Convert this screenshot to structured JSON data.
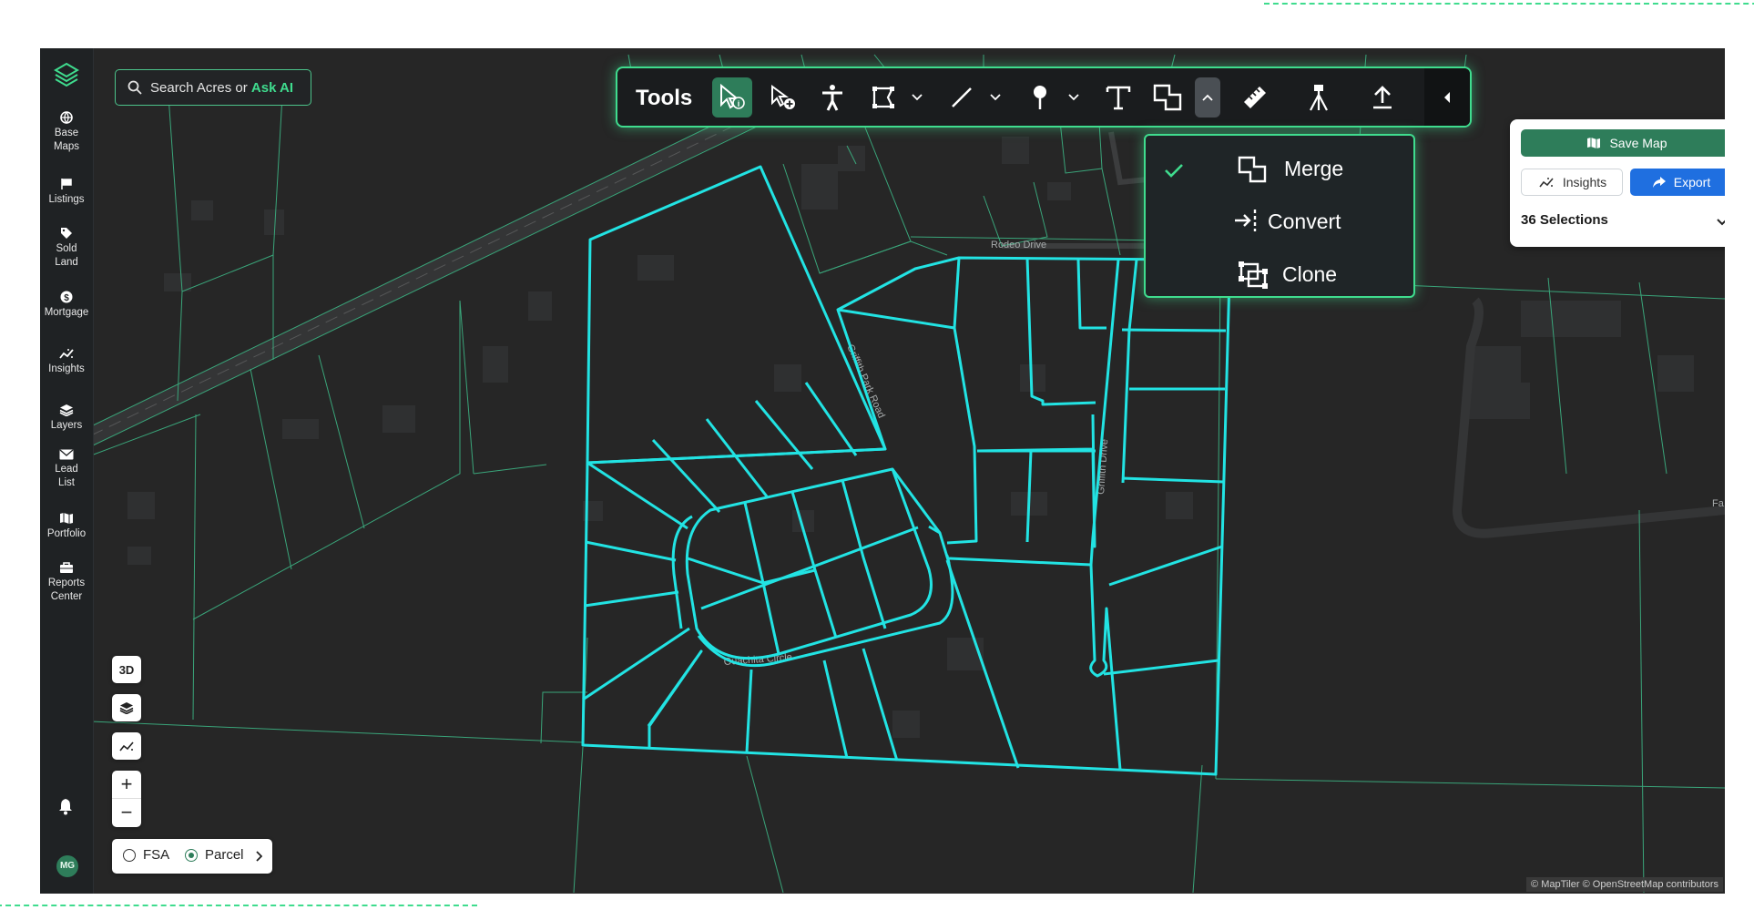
{
  "colors": {
    "accent": "#3fdc8e",
    "parcel_selected": "#22e3e3",
    "parcel_line": "#3aa57a",
    "map_bg": "#262626",
    "save_button": "#2e7d5a",
    "export_button": "#1f6fe0"
  },
  "sidebar": {
    "logo_icon": "layers-logo-icon",
    "items": [
      {
        "label": "Base\nMaps",
        "icon": "globe-icon"
      },
      {
        "label": "Listings",
        "icon": "flag-icon"
      },
      {
        "label": "Sold\nLand",
        "icon": "tag-icon"
      },
      {
        "label": "Mortgage",
        "icon": "dollar-icon"
      },
      {
        "label": "Insights",
        "icon": "chart-icon"
      },
      {
        "label": "Layers",
        "icon": "layers-icon"
      },
      {
        "label": "Lead\nList",
        "icon": "envelope-icon"
      },
      {
        "label": "Portfolio",
        "icon": "map-icon"
      },
      {
        "label": "Reports\nCenter",
        "icon": "briefcase-icon"
      }
    ],
    "notifications_icon": "bell-icon",
    "avatar_initials": "MG"
  },
  "search": {
    "prefix": "Search Acres or ",
    "ask_ai": "Ask AI"
  },
  "toolbar": {
    "label": "Tools",
    "tools": [
      "select-info",
      "select-add",
      "person",
      "polygon",
      "line",
      "pin",
      "text",
      "merge",
      "ruler",
      "survey",
      "upload"
    ],
    "active_tool": "select-info",
    "open_dropdown": "merge"
  },
  "merge_menu": {
    "items": [
      {
        "label": "Merge",
        "icon": "merge-icon",
        "checked": true
      },
      {
        "label": "Convert",
        "icon": "convert-icon",
        "checked": false
      },
      {
        "label": "Clone",
        "icon": "clone-icon",
        "checked": false
      }
    ]
  },
  "panel": {
    "save_label": "Save Map",
    "insights_label": "Insights",
    "export_label": "Export",
    "selections_label": "36 Selections"
  },
  "map": {
    "streets": [
      "Rodeo Drive",
      "Griffith Park Road",
      "Griffith Drive",
      "Ouachita Circle"
    ],
    "edge_label": "Fa",
    "attribution": "© MapTiler © OpenStreetMap contributors"
  },
  "controls": {
    "three_d_label": "3D",
    "zoom_in": "+",
    "zoom_out": "−",
    "layer_options": [
      {
        "label": "FSA",
        "selected": false
      },
      {
        "label": "Parcel",
        "selected": true
      }
    ]
  }
}
